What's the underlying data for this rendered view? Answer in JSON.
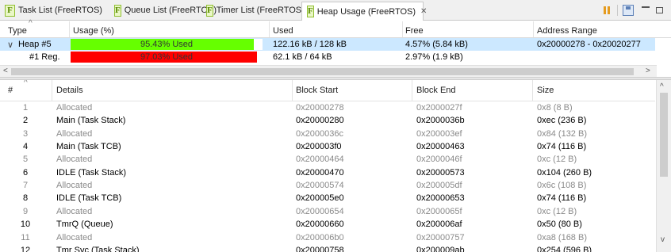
{
  "tabs": [
    {
      "label": "Task List (FreeRTOS)",
      "icon": "freertos-f-icon",
      "active": false
    },
    {
      "label": "Queue List (FreeRTOS)",
      "icon": "freertos-f-icon",
      "active": false
    },
    {
      "label": "Timer List (FreeRTOS)",
      "icon": "freertos-f-icon",
      "active": false
    },
    {
      "label": "Heap Usage (FreeRTOS)",
      "icon": "freertos-f-icon",
      "active": true
    }
  ],
  "tab_close_glyph": "✕",
  "toolbar_icons": [
    "pause-icon",
    "save-icon",
    "minimize-icon",
    "maximize-icon"
  ],
  "top_table": {
    "headers": [
      "Type",
      "Usage (%)",
      "Used",
      "Free",
      "Address Range"
    ],
    "sort_indicator": "^",
    "rows": [
      {
        "expander": "∨",
        "type": "Heap #5",
        "usage_label": "95.43% Used",
        "usage_pct": 95.43,
        "bar_color": "#66ff00",
        "used": "122.16 kB / 128 kB",
        "free": "4.57% (5.84 kB)",
        "range": "0x20000278 - 0x20020277",
        "selected": true
      },
      {
        "expander": "",
        "type": "#1 Reg.",
        "usage_label": "97.03% Used",
        "usage_pct": 97.03,
        "bar_color": "#ff0000",
        "used": "62.1 kB / 64 kB",
        "free": "2.97% (1.9 kB)",
        "range": "",
        "selected": false
      }
    ]
  },
  "bottom_table": {
    "headers": [
      "#",
      "Details",
      "Block Start",
      "Block End",
      "Size"
    ],
    "sort_indicator": "^",
    "rows": [
      {
        "n": "1",
        "details": "Allocated",
        "start": "0x20000278",
        "end": "0x2000027f",
        "size": "0x8 (8 B)",
        "grey": true
      },
      {
        "n": "2",
        "details": "Main (Task Stack)",
        "start": "0x20000280",
        "end": "0x2000036b",
        "size": "0xec (236 B)",
        "grey": false
      },
      {
        "n": "3",
        "details": "Allocated",
        "start": "0x2000036c",
        "end": "0x200003ef",
        "size": "0x84 (132 B)",
        "grey": true
      },
      {
        "n": "4",
        "details": "Main (Task TCB)",
        "start": "0x200003f0",
        "end": "0x20000463",
        "size": "0x74 (116 B)",
        "grey": false
      },
      {
        "n": "5",
        "details": "Allocated",
        "start": "0x20000464",
        "end": "0x2000046f",
        "size": "0xc (12 B)",
        "grey": true
      },
      {
        "n": "6",
        "details": "IDLE (Task Stack)",
        "start": "0x20000470",
        "end": "0x20000573",
        "size": "0x104 (260 B)",
        "grey": false
      },
      {
        "n": "7",
        "details": "Allocated",
        "start": "0x20000574",
        "end": "0x200005df",
        "size": "0x6c (108 B)",
        "grey": true
      },
      {
        "n": "8",
        "details": "IDLE (Task TCB)",
        "start": "0x200005e0",
        "end": "0x20000653",
        "size": "0x74 (116 B)",
        "grey": false
      },
      {
        "n": "9",
        "details": "Allocated",
        "start": "0x20000654",
        "end": "0x2000065f",
        "size": "0xc (12 B)",
        "grey": true
      },
      {
        "n": "10",
        "details": "TmrQ (Queue)",
        "start": "0x20000660",
        "end": "0x200006af",
        "size": "0x50 (80 B)",
        "grey": false
      },
      {
        "n": "11",
        "details": "Allocated",
        "start": "0x200006b0",
        "end": "0x20000757",
        "size": "0xa8 (168 B)",
        "grey": true
      },
      {
        "n": "12",
        "details": "Tmr Svc (Task Stack)",
        "start": "0x20000758",
        "end": "0x200009ab",
        "size": "0x254 (596 B)",
        "grey": false
      }
    ]
  },
  "scroll_arrows": {
    "left": "<",
    "right": ">",
    "up": "^",
    "down": "v"
  }
}
